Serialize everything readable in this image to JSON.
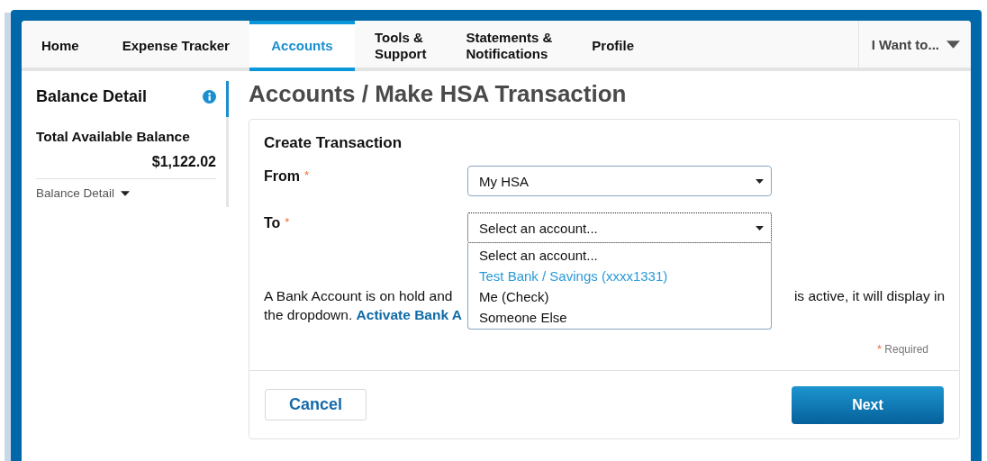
{
  "nav": {
    "tabs": [
      {
        "label": "Home",
        "selected": false
      },
      {
        "label": "Expense Tracker",
        "selected": false
      },
      {
        "label": "Accounts",
        "selected": true
      },
      {
        "label": "Tools &\nSupport",
        "selected": false
      },
      {
        "label": "Statements &\nNotifications",
        "selected": false
      },
      {
        "label": "Profile",
        "selected": false
      }
    ],
    "menu": "I Want to..."
  },
  "sidebar": {
    "title": "Balance Detail",
    "total_label": "Total Available Balance",
    "total": "$1,122.02",
    "toggle": "Balance Detail"
  },
  "page_title": "Accounts / Make HSA Transaction",
  "form": {
    "title": "Create Transaction",
    "fields": [
      {
        "label": "From",
        "required_mark": "*",
        "value": "My HSA",
        "open": false
      },
      {
        "label": "To",
        "required_mark": "*",
        "value": "Select an account...",
        "open": true,
        "options": [
          {
            "label": "Select an account...",
            "highlighted": false
          },
          {
            "label": "Test Bank / Savings (xxxx1331)",
            "highlighted": true
          },
          {
            "label": "Me (Check)",
            "highlighted": false
          },
          {
            "label": "Someone Else",
            "highlighted": false
          }
        ]
      }
    ],
    "notice_left": "A Bank Account is on hold and",
    "notice_right": "is active, it will display in",
    "notice_line2": "the dropdown.",
    "notice_link": "Activate Bank A",
    "required_mark": "*",
    "required_note": "Required",
    "buttons": {
      "cancel": "Cancel",
      "next": "Next"
    }
  }
}
